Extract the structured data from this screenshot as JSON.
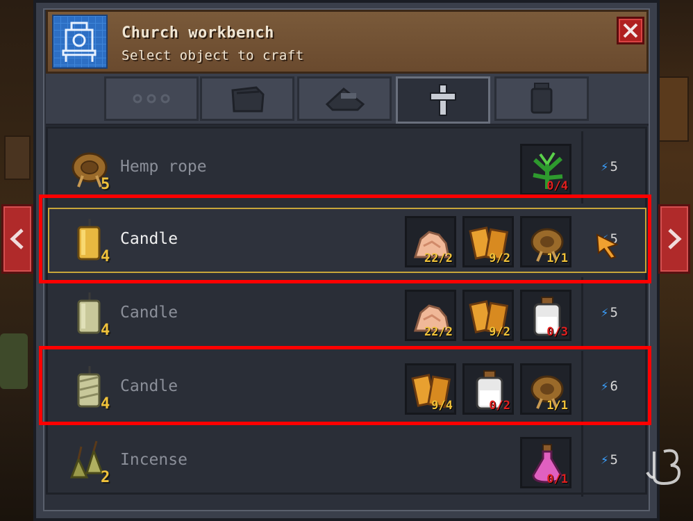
{
  "header": {
    "title": "Church workbench",
    "subtitle": "Select object to craft",
    "icon": "workbench-blueprint-icon",
    "close_icon": "close-icon"
  },
  "tabs": [
    {
      "icon": "more-dots-icon",
      "active": false
    },
    {
      "icon": "bag-icon",
      "active": false
    },
    {
      "icon": "anvil-icon",
      "active": false
    },
    {
      "icon": "church-cross-icon",
      "active": true
    },
    {
      "icon": "jar-icon",
      "active": false
    }
  ],
  "recipes": [
    {
      "name": "Hemp rope",
      "qty": "5",
      "icon": "hemp-rope-icon",
      "enabled": false,
      "ingredients": [
        {
          "icon": "hemp-leaves-icon",
          "count": "0/4",
          "ok": false
        }
      ],
      "energy": "5"
    },
    {
      "name": "Candle",
      "qty": "4",
      "icon": "candle-icon",
      "enabled": true,
      "selected": true,
      "ingredients": [
        {
          "icon": "beeswax-icon",
          "count": "22/2",
          "ok": true
        },
        {
          "icon": "honeycomb-icon",
          "count": "9/2",
          "ok": true
        },
        {
          "icon": "hemp-rope-icon",
          "count": "1/1",
          "ok": true
        }
      ],
      "energy": "5"
    },
    {
      "name": "Candle",
      "qty": "4",
      "icon": "candle-icon",
      "enabled": false,
      "ingredients": [
        {
          "icon": "beeswax-icon",
          "count": "22/2",
          "ok": true
        },
        {
          "icon": "honeycomb-icon",
          "count": "9/2",
          "ok": true
        },
        {
          "icon": "white-potion-icon",
          "count": "0/3",
          "ok": false
        }
      ],
      "energy": "5"
    },
    {
      "name": "Candle",
      "qty": "4",
      "icon": "twisted-candle-icon",
      "enabled": false,
      "ingredients": [
        {
          "icon": "honeycomb-icon",
          "count": "9/4",
          "ok": true
        },
        {
          "icon": "white-potion-icon",
          "count": "0/2",
          "ok": false
        },
        {
          "icon": "hemp-rope-icon",
          "count": "1/1",
          "ok": true
        }
      ],
      "energy": "6"
    },
    {
      "name": "Incense",
      "qty": "2",
      "icon": "incense-icon",
      "enabled": false,
      "ingredients": [
        {
          "icon": "pink-potion-icon",
          "count": "0/1",
          "ok": false
        }
      ],
      "energy": "5"
    }
  ],
  "colors": {
    "highlight": "#ff0000",
    "ok_count": "#f0c23a",
    "missing_count": "#e02020",
    "energy_bolt": "#3aa0ff"
  }
}
